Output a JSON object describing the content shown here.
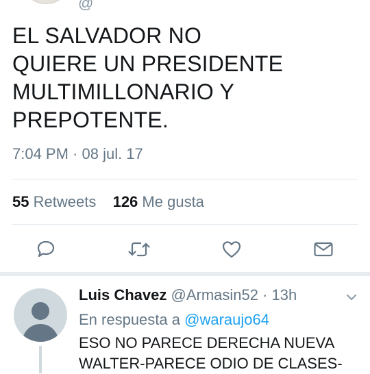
{
  "tweet": {
    "text_lines": [
      "EL SALVADOR NO",
      "QUIERE UN PRESIDENTE",
      "MULTIMILLONARIO Y",
      "PREPOTENTE."
    ],
    "timestamp": "7:04 PM · 08 jul. 17",
    "stats": {
      "retweets_count": "55",
      "retweets_label": "Retweets",
      "likes_count": "126",
      "likes_label": "Me gusta"
    },
    "actions": [
      "reply-icon",
      "retweet-icon",
      "like-icon",
      "share-icon"
    ]
  },
  "reply": {
    "name": "Luis Chavez",
    "handle": "@Armasin52",
    "time": " · 13h",
    "reply_prefix": "En respuesta a ",
    "reply_mention": "@waraujo64",
    "text_lines": [
      "ESO NO PARECE DERECHA NUEVA",
      "WALTER-PARECE ODIO DE CLASES-"
    ]
  },
  "colors": {
    "accent": "#1da1f2",
    "secondary_text": "#657786",
    "icon": "#657786"
  }
}
